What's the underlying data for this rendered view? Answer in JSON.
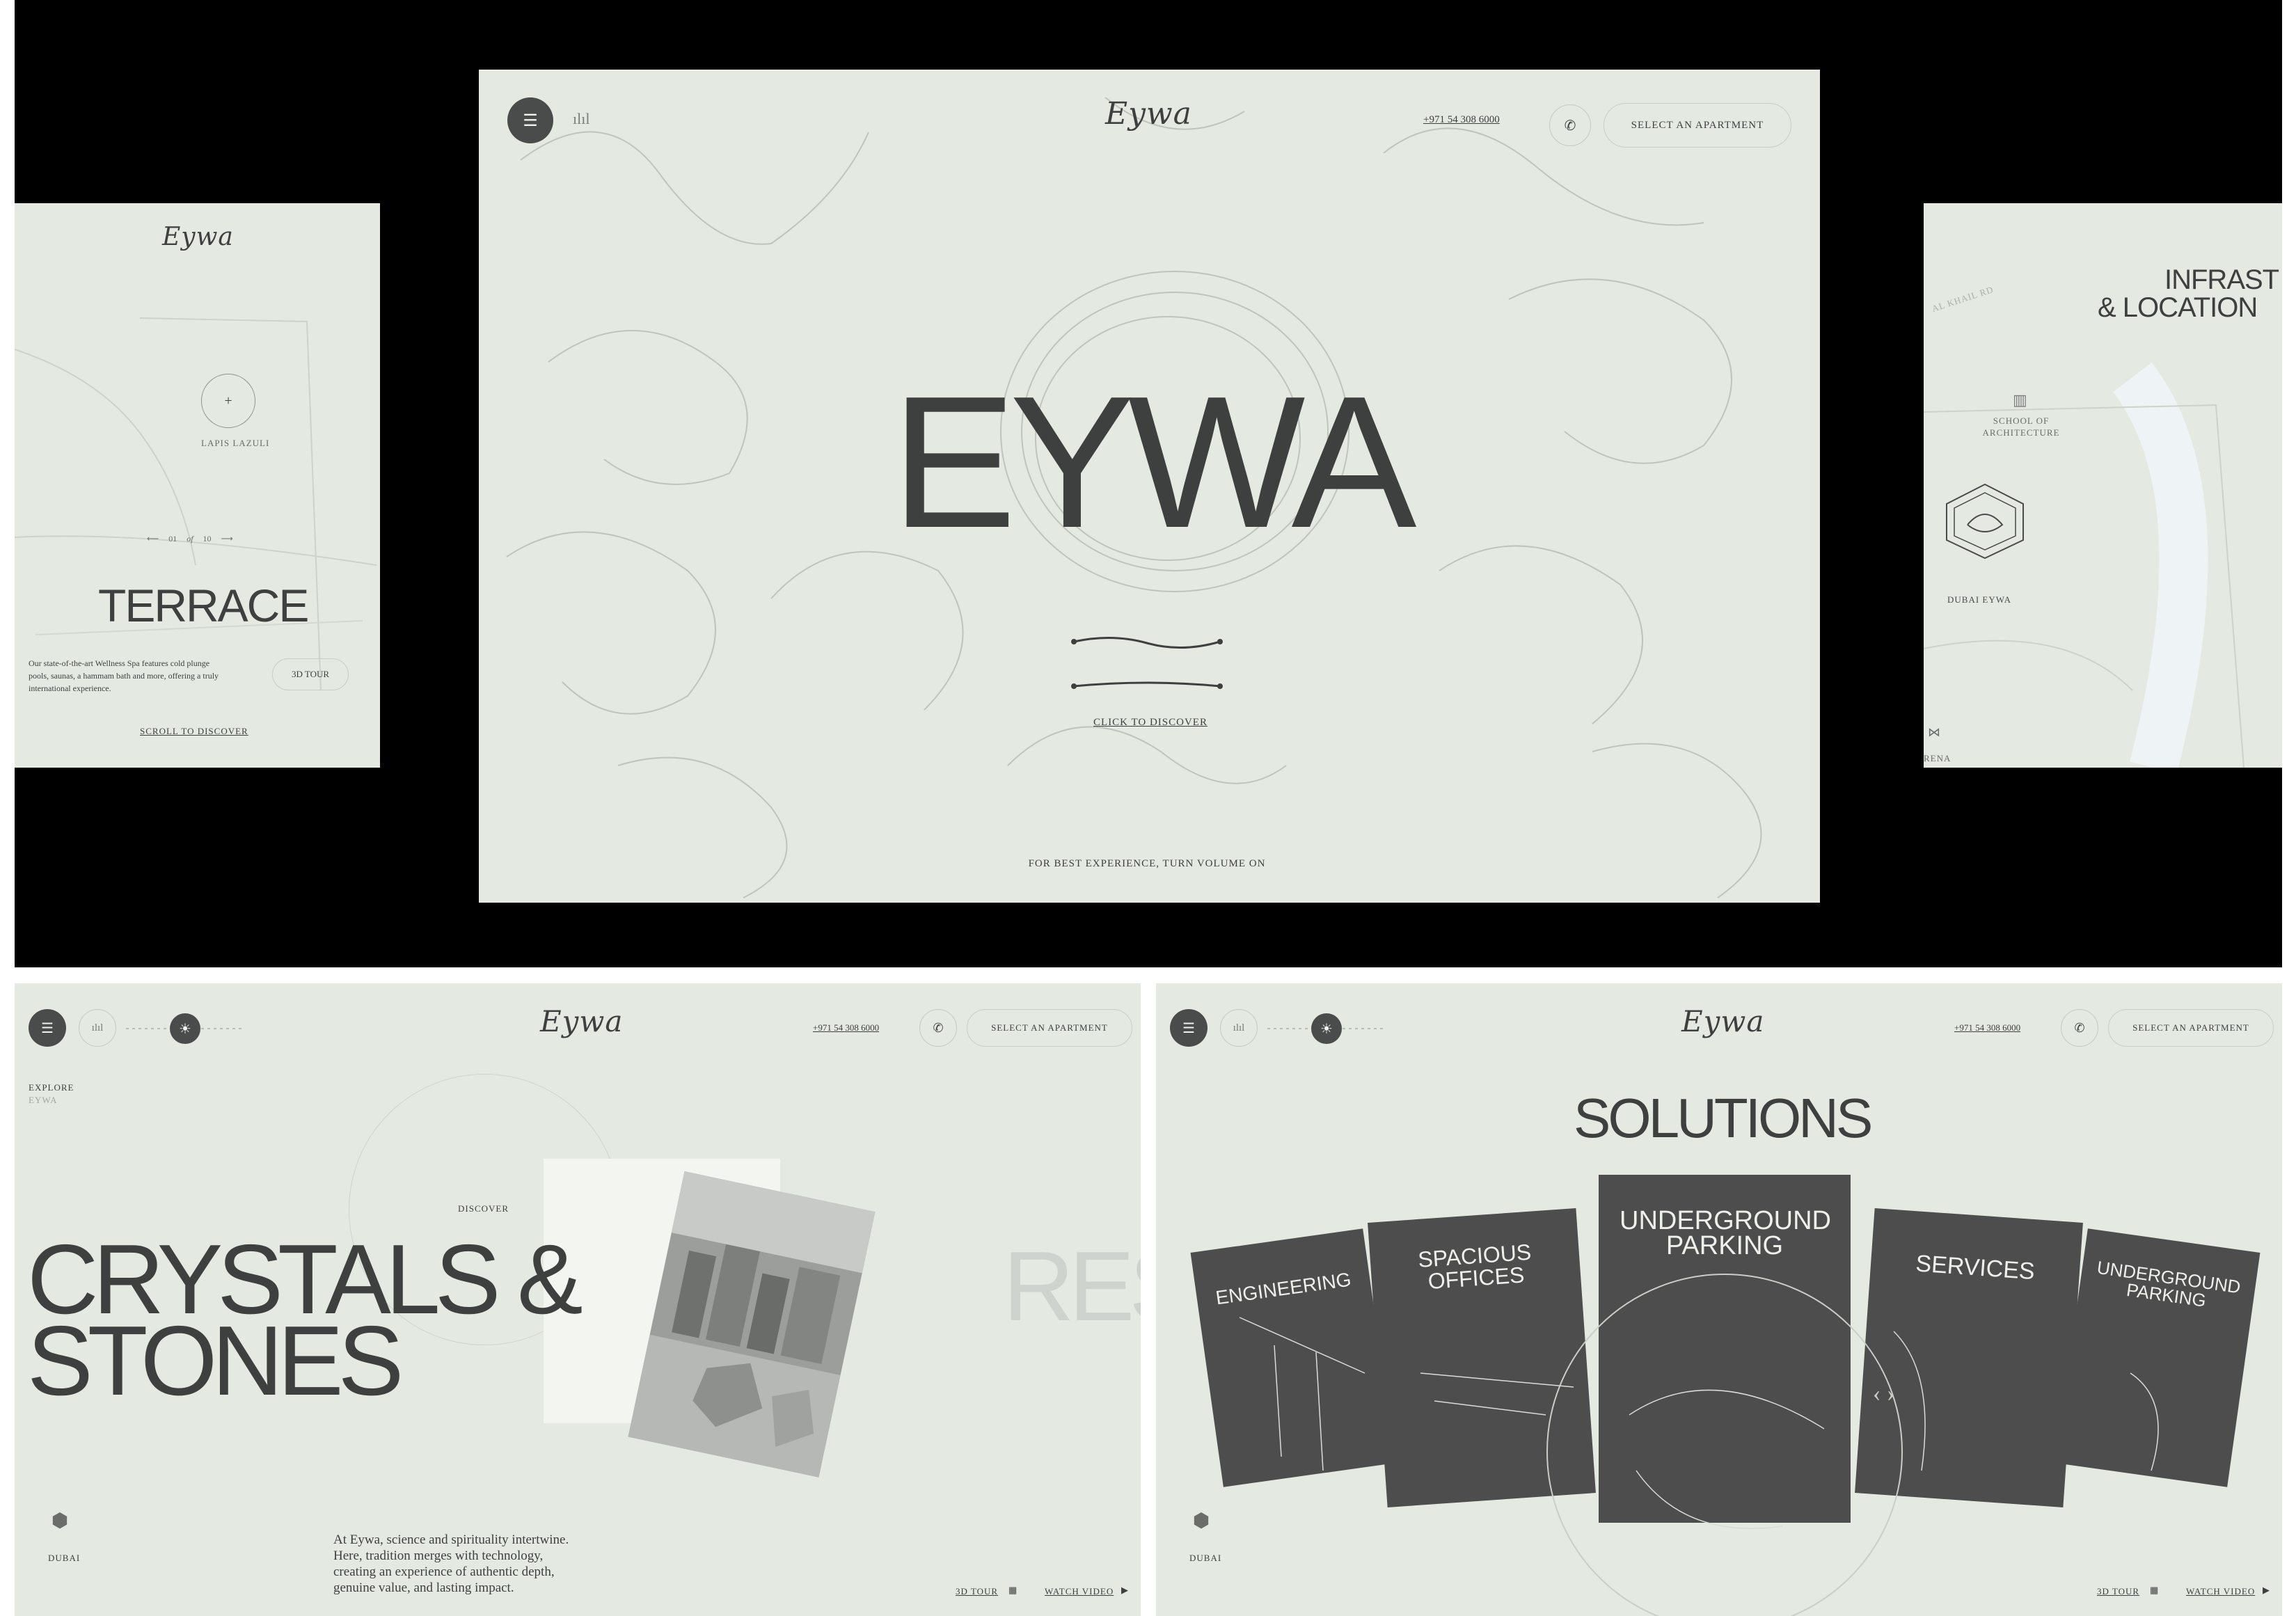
{
  "left_panel": {
    "logo": "Eywa",
    "marker_label": "LAPIS LAZULI",
    "pager_current": "01",
    "pager_sep": "of",
    "pager_total": "10",
    "title": "TERRACE",
    "description": "Our state-of-the-art Wellness Spa features cold plunge pools, saunas, a hammam bath and more, offering a truly international experience.",
    "tour_button": "3D TOUR",
    "scroll_link": "SCROLL TO DISCOVER"
  },
  "hero": {
    "logo": "Eywa",
    "phone": "+971 54 308 6000",
    "select_button": "SELECT AN APARTMENT",
    "title": "EYWA",
    "cta": "CLICK TO DISCOVER",
    "footer_note": "FOR BEST EXPERIENCE, TURN VOLUME ON"
  },
  "right_panel": {
    "title_line1": "INFRAST",
    "title_line2": "& LOCATION",
    "street_label": "AL KHAIL RD",
    "poi1_line1": "SCHOOL OF",
    "poi1_line2": "ARCHITECTURE",
    "poi2": "DUBAI EYWA",
    "poi3": "RENA"
  },
  "bottom_left": {
    "logo": "Eywa",
    "phone": "+971 54 308 6000",
    "select_button": "SELECT AN APARTMENT",
    "explore_label": "EXPLORE",
    "explore_sub": "EYWA",
    "discover_label": "DISCOVER",
    "title_line1": "CRYSTALS &",
    "title_line2": "STONES",
    "ghost_title": "RES",
    "location_label": "DUBAI",
    "description_lines": [
      "At Eywa, science and spirituality intertwine.",
      "Here, tradition merges with technology,",
      "creating an experience of authentic depth,",
      "genuine value, and lasting impact."
    ],
    "tour_link": "3D TOUR",
    "video_link": "WATCH VIDEO"
  },
  "bottom_right": {
    "logo": "Eywa",
    "phone": "+971 54 308 6000",
    "select_button": "SELECT AN APARTMENT",
    "title": "SOLUTIONS",
    "cards": [
      "ENGINEERING",
      "SPACIOUS OFFICES",
      "UNDERGROUND PARKING",
      "SERVICES",
      "UNDERGROUND PARKING"
    ],
    "location_label": "DUBAI",
    "tour_link": "3D TOUR",
    "video_link": "WATCH VIDEO"
  },
  "colors": {
    "panel_bg": "#e4e9e2",
    "ink": "#3e403f",
    "card_bg": "#4d4d4d",
    "line": "#c5cbc3"
  }
}
